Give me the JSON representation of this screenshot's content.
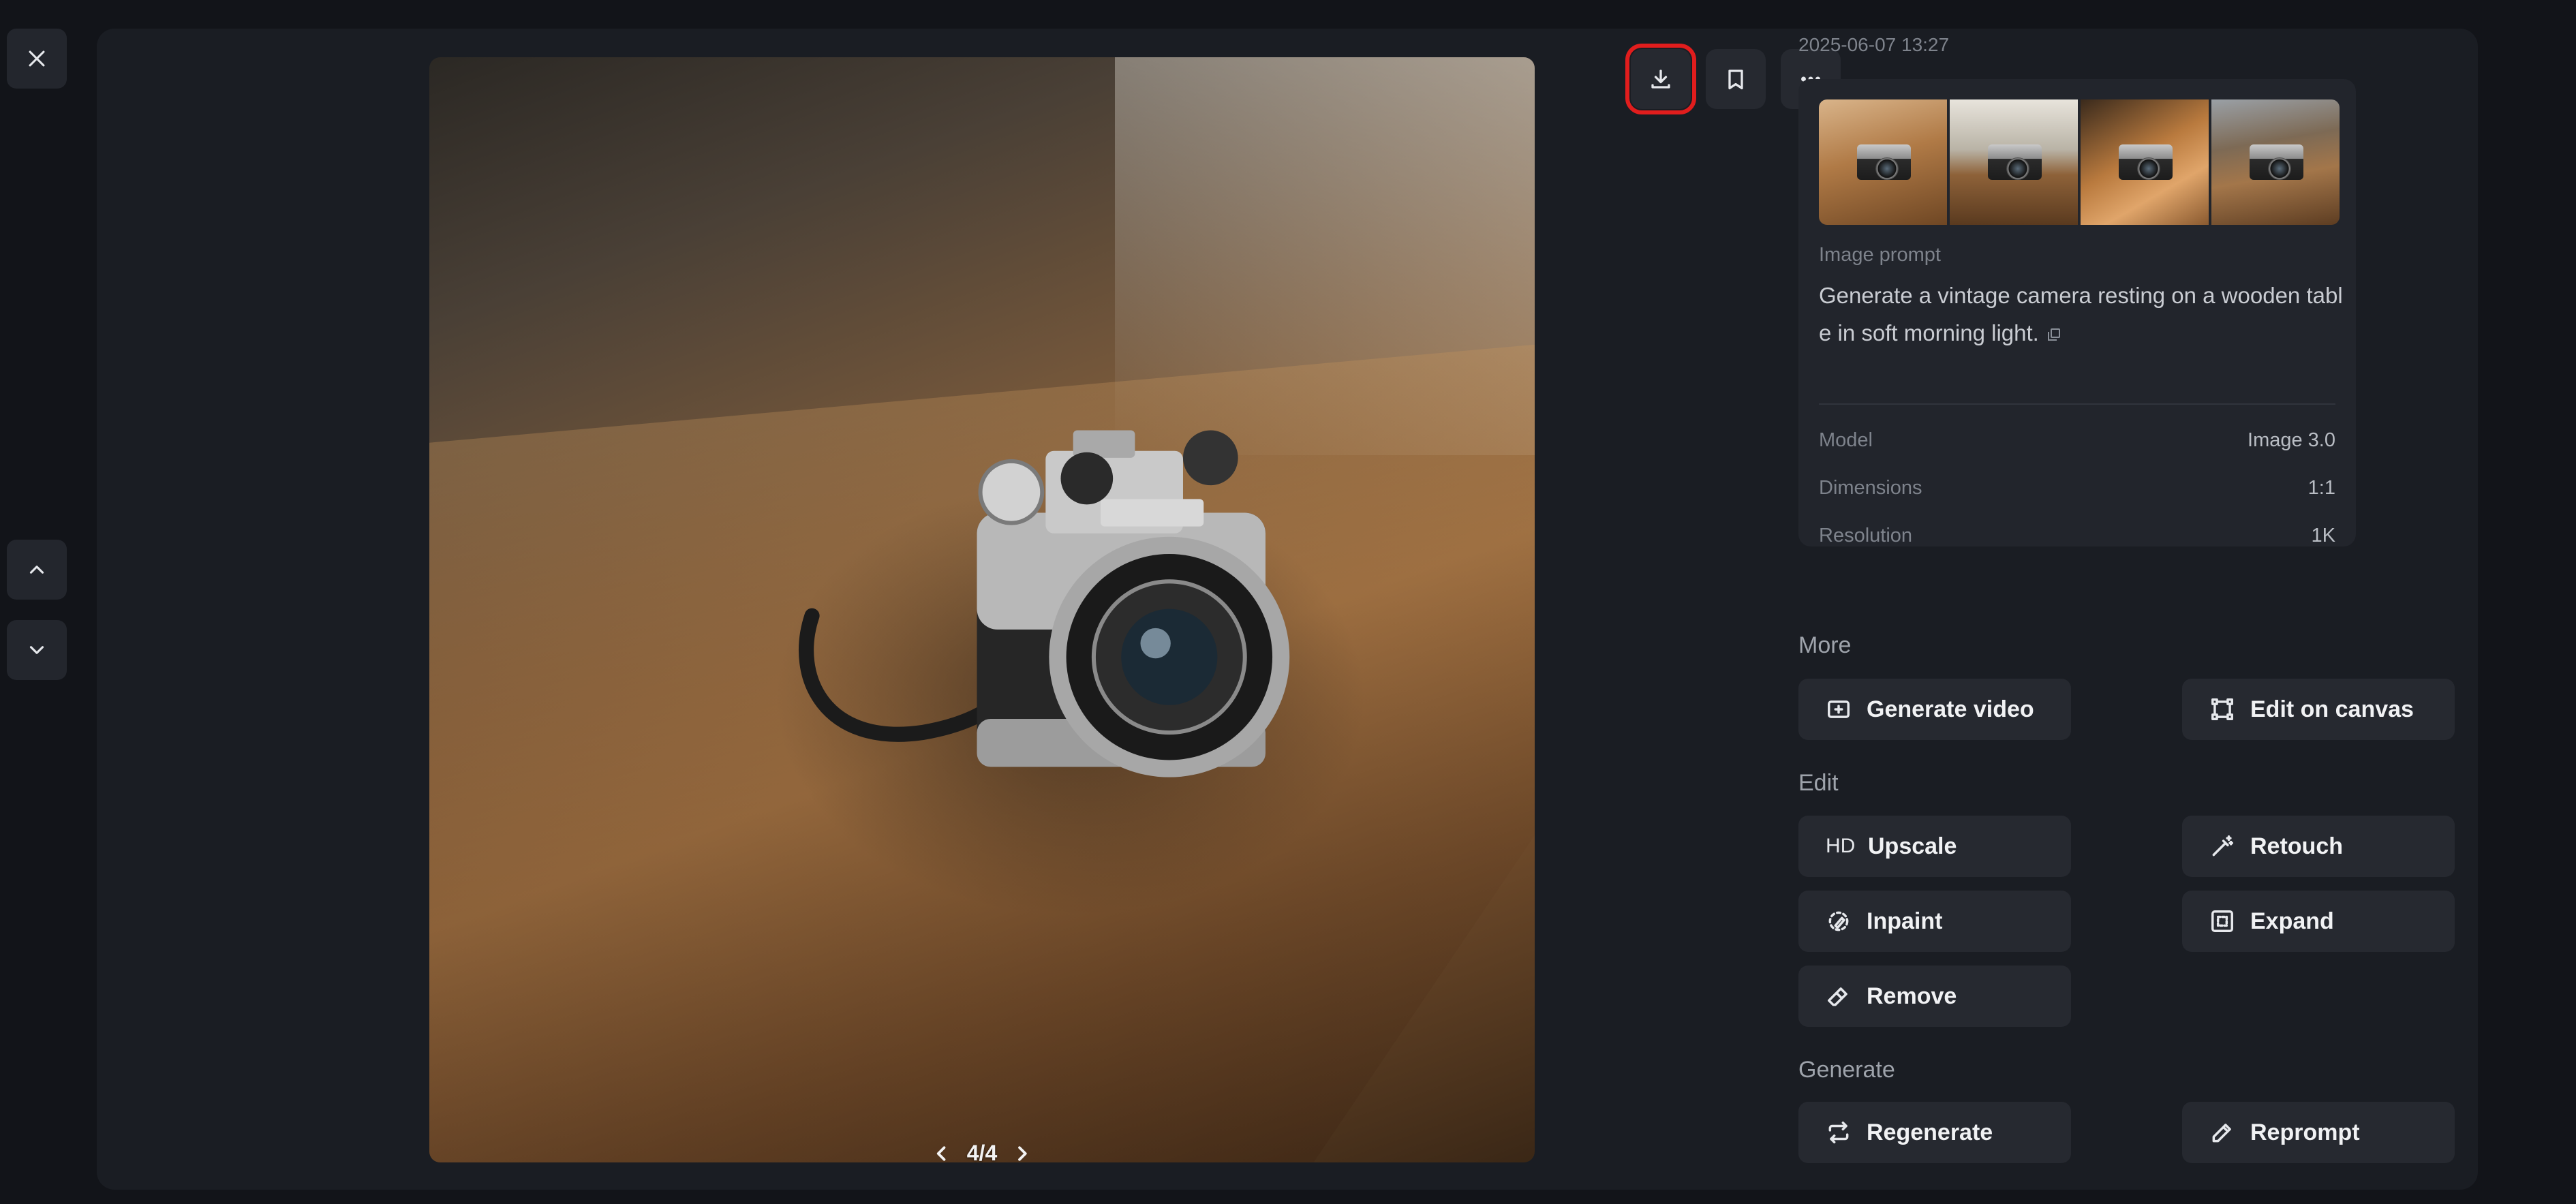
{
  "nav": {
    "close_icon": "close-icon",
    "up_icon": "chevron-up-icon",
    "down_icon": "chevron-down-icon"
  },
  "viewer": {
    "pager_text": "4/4",
    "actions": [
      {
        "name": "download",
        "icon": "download-icon",
        "highlighted": true
      },
      {
        "name": "bookmark",
        "icon": "bookmark-icon"
      },
      {
        "name": "more",
        "icon": "more-horizontal-icon"
      }
    ]
  },
  "info": {
    "timestamp": "2025-06-07 13:27",
    "prompt_label": "Image prompt",
    "prompt_text": "Generate a vintage camera resting on a wooden table in soft morning light.",
    "meta": [
      {
        "key": "Model",
        "value": "Image 3.0"
      },
      {
        "key": "Dimensions",
        "value": "1:1"
      },
      {
        "key": "Resolution",
        "value": "1K"
      }
    ]
  },
  "sections": {
    "more": {
      "title": "More",
      "buttons": [
        {
          "label": "Generate video",
          "icon": "video-plus-icon"
        },
        {
          "label": "Edit on canvas",
          "icon": "canvas-icon"
        }
      ]
    },
    "edit": {
      "title": "Edit",
      "buttons": [
        {
          "label": "Upscale",
          "icon_text": "HD"
        },
        {
          "label": "Retouch",
          "icon": "magic-wand-icon"
        },
        {
          "label": "Inpaint",
          "icon": "brush-icon"
        },
        {
          "label": "Expand",
          "icon": "expand-icon"
        },
        {
          "label": "Remove",
          "icon": "eraser-icon"
        }
      ]
    },
    "generate": {
      "title": "Generate",
      "buttons": [
        {
          "label": "Regenerate",
          "icon": "repeat-icon"
        },
        {
          "label": "Reprompt",
          "icon": "pencil-icon"
        }
      ]
    }
  },
  "colors": {
    "background": "#121419",
    "panel": "#1a1d23",
    "button": "#262930",
    "highlight": "#e11d1d"
  }
}
